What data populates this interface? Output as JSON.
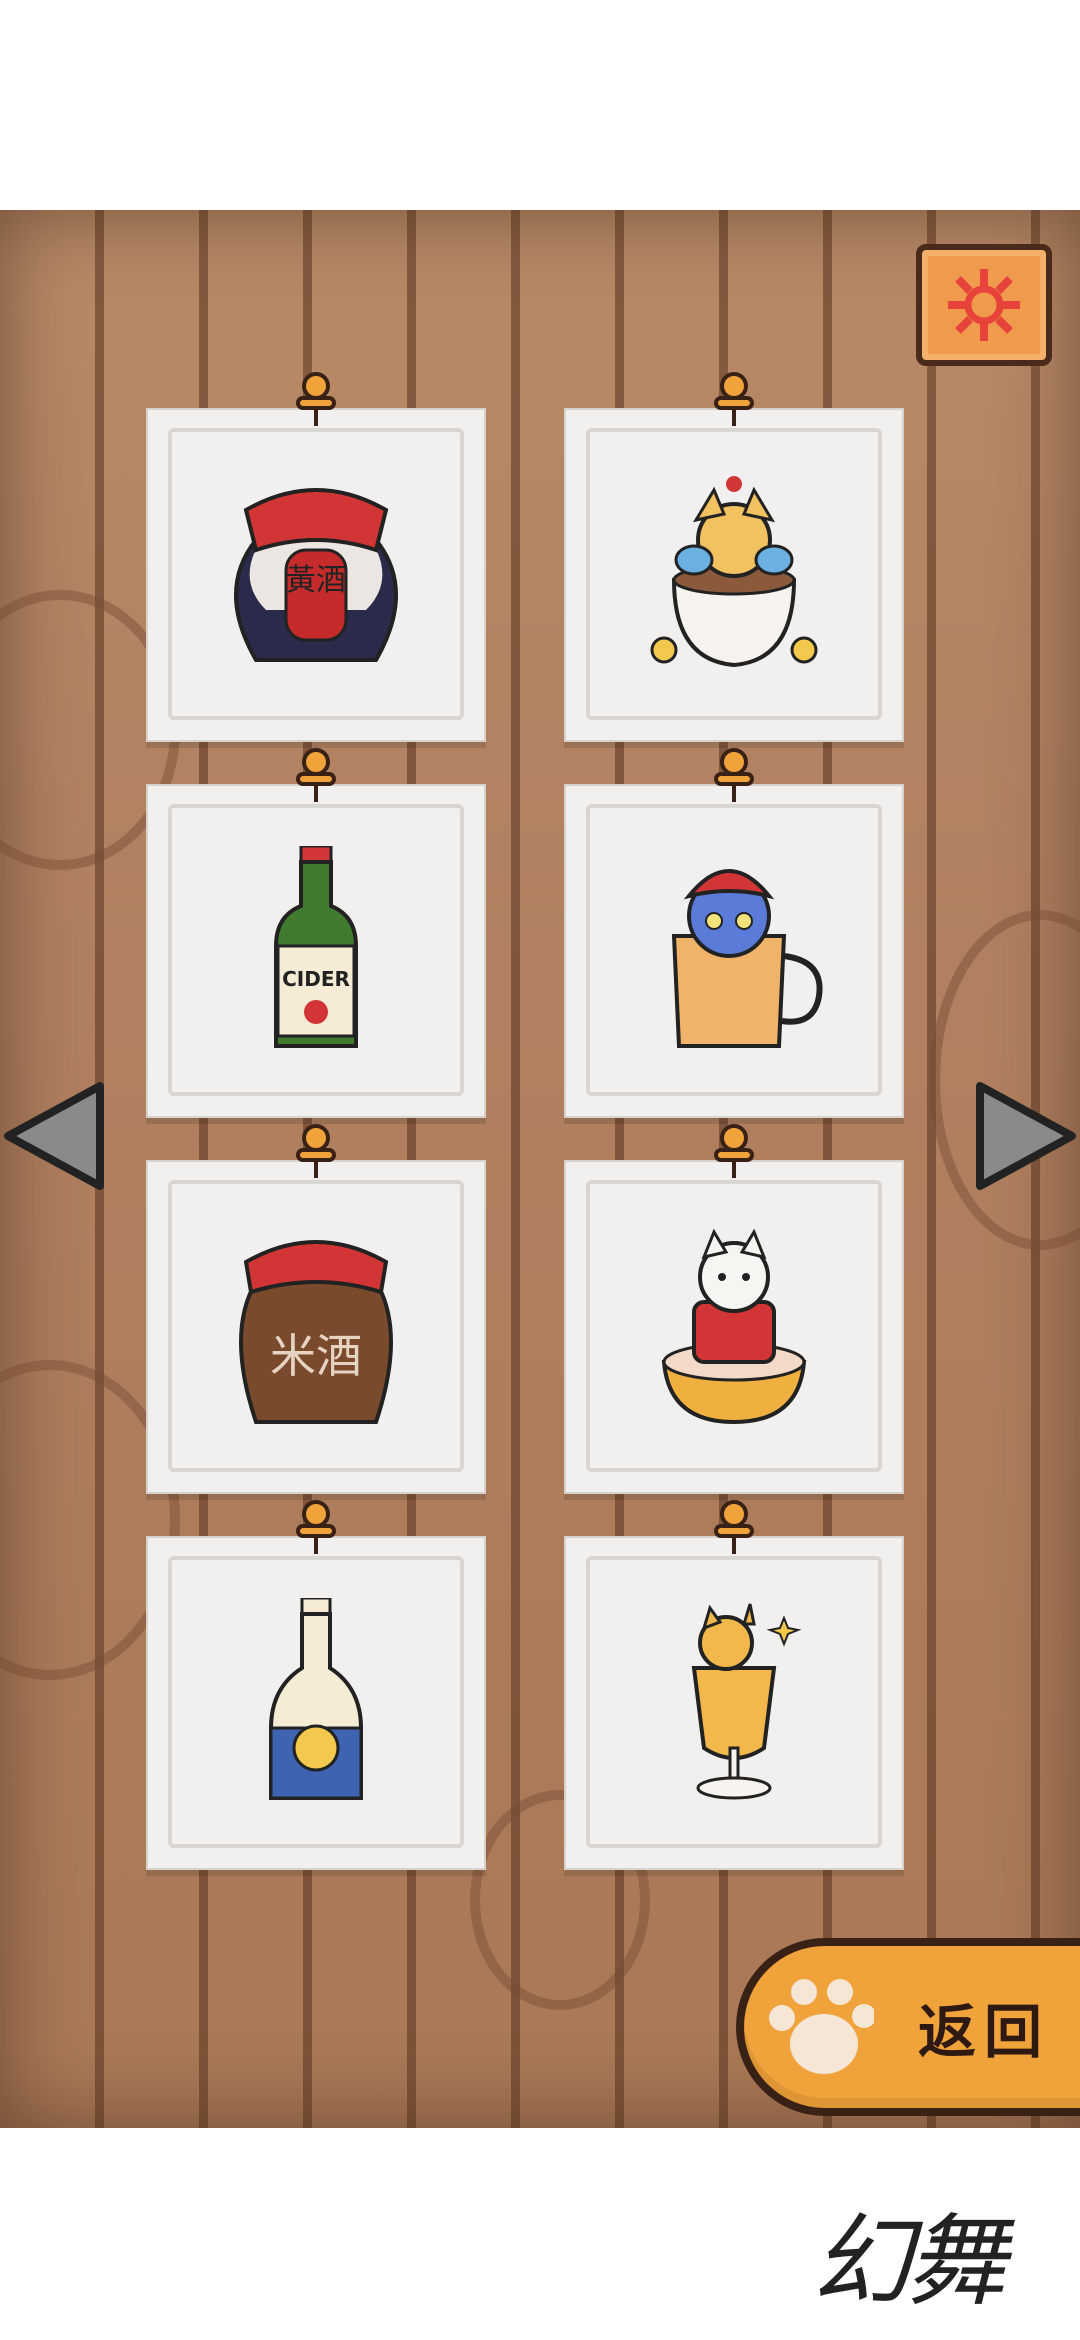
{
  "colors": {
    "wood": "#b08060",
    "wood_stripe": "#6e3e26",
    "card": "#f2f0ee",
    "accent_orange": "#f09a4d",
    "back_orange": "#f0a23b",
    "outline": "#3a2116"
  },
  "settings": {
    "icon": "sun-gear-icon"
  },
  "cards": [
    {
      "item": "yellow-wine-jar",
      "text": "黃酒"
    },
    {
      "item": "golden-armor-cat-cup"
    },
    {
      "item": "cider-bottle",
      "text": "CIDER"
    },
    {
      "item": "apple-hat-cat-beer-mug"
    },
    {
      "item": "rice-wine-jar",
      "text": "米酒"
    },
    {
      "item": "cat-rice-bowl"
    },
    {
      "item": "blue-liquor-bottle"
    },
    {
      "item": "dancing-cat-glass"
    }
  ],
  "nav": {
    "prev_icon": "triangle-left-icon",
    "next_icon": "triangle-right-icon"
  },
  "back_button": {
    "label": "返回",
    "icon": "paw-icon"
  },
  "watermark": "幻舞"
}
